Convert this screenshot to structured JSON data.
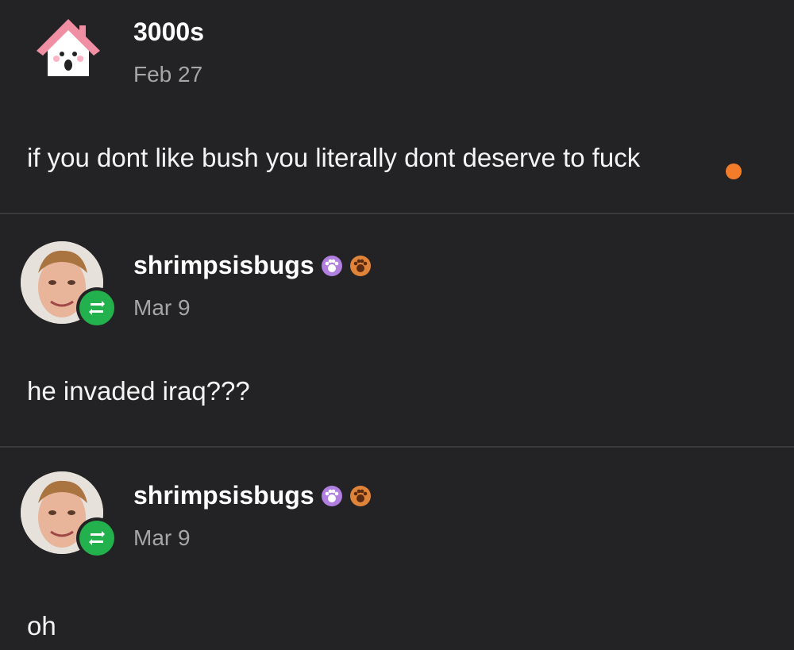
{
  "posts": [
    {
      "username": "3000s",
      "date": "Feb 27",
      "body": "if you dont like bush you literally dont deserve to fuck",
      "avatar_icon": "house-icon"
    },
    {
      "username": "shrimpsisbugs",
      "date": "Mar 9",
      "body": "he invaded iraq???",
      "avatar_icon": "person-avatar",
      "badge_icon": "reblog-icon",
      "badges": [
        "purple-paw-badge",
        "orange-paw-badge"
      ]
    },
    {
      "username": "shrimpsisbugs",
      "date": "Mar 9",
      "body": "oh",
      "avatar_icon": "person-avatar",
      "badge_icon": "reblog-icon",
      "badges": [
        "purple-paw-badge",
        "orange-paw-badge"
      ]
    }
  ],
  "colors": {
    "background": "#232325",
    "reblog_green": "#22b14c",
    "date_gray": "#a6a6a9",
    "paw_purple": "#b07fe0",
    "paw_orange": "#e0843a",
    "dot_orange": "#f27c2a"
  }
}
